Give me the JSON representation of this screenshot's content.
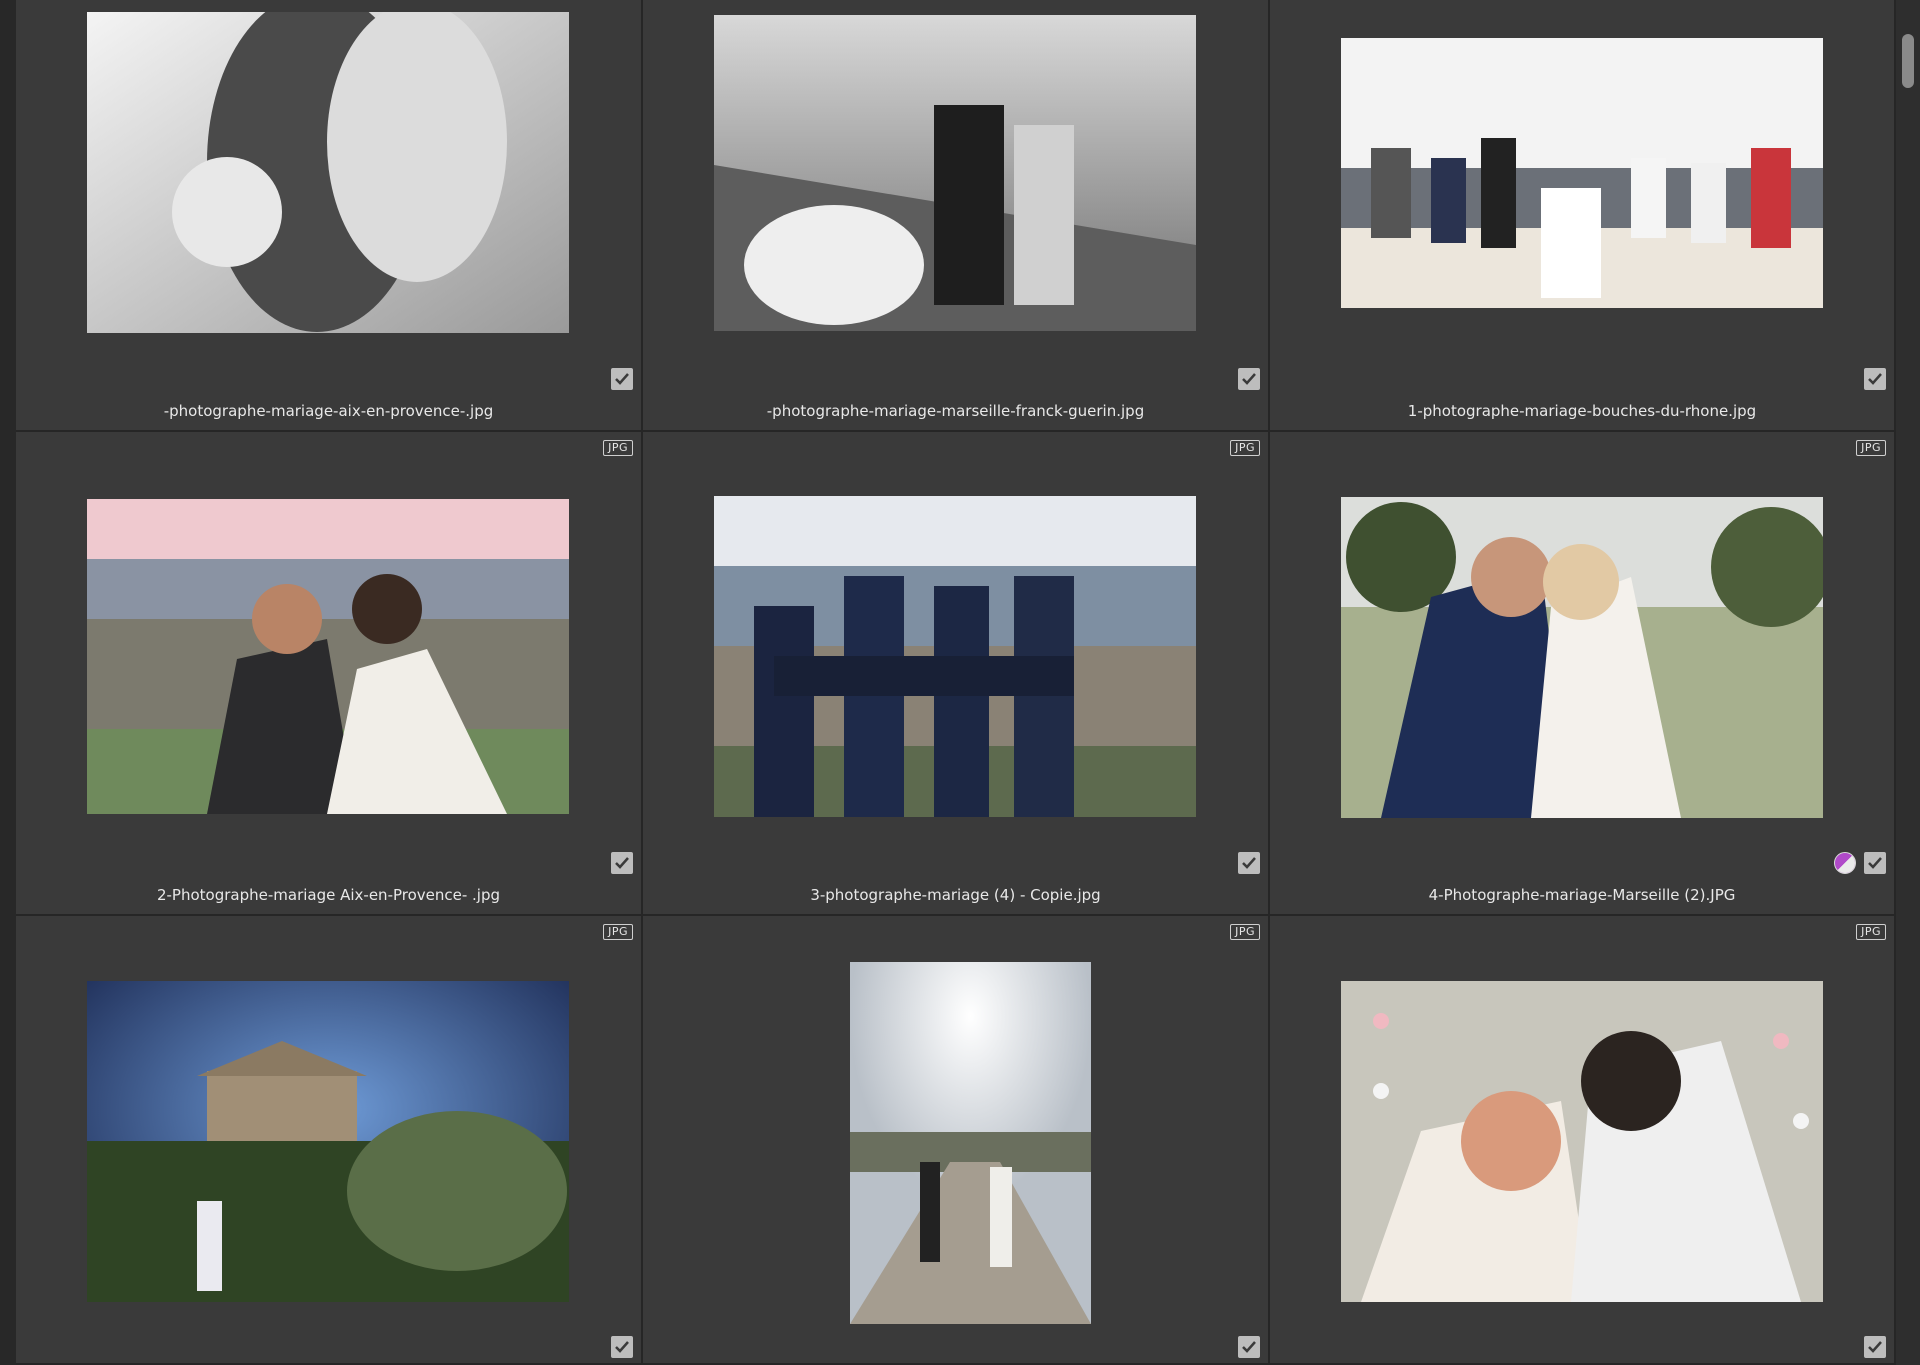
{
  "badge_label": "JPG",
  "cells": [
    {
      "name": "-photographe-mariage-aix-en-provence-.jpg",
      "badge": false,
      "adjusted": false,
      "checked": true
    },
    {
      "name": "-photographe-mariage-marseille-franck-guerin.jpg",
      "badge": false,
      "adjusted": false,
      "checked": true
    },
    {
      "name": "1-photographe-mariage-bouches-du-rhone.jpg",
      "badge": false,
      "adjusted": false,
      "checked": true
    },
    {
      "name": "2-Photographe-mariage Aix-en-Provence- .jpg",
      "badge": true,
      "adjusted": false,
      "checked": true
    },
    {
      "name": "3-photographe-mariage (4) - Copie.jpg",
      "badge": true,
      "adjusted": false,
      "checked": true
    },
    {
      "name": "4-Photographe-mariage-Marseille (2).JPG",
      "badge": true,
      "adjusted": true,
      "checked": true
    },
    {
      "name": "",
      "badge": true,
      "adjusted": false,
      "checked": true
    },
    {
      "name": "",
      "badge": true,
      "adjusted": false,
      "checked": true
    },
    {
      "name": "",
      "badge": true,
      "adjusted": false,
      "checked": true
    }
  ]
}
